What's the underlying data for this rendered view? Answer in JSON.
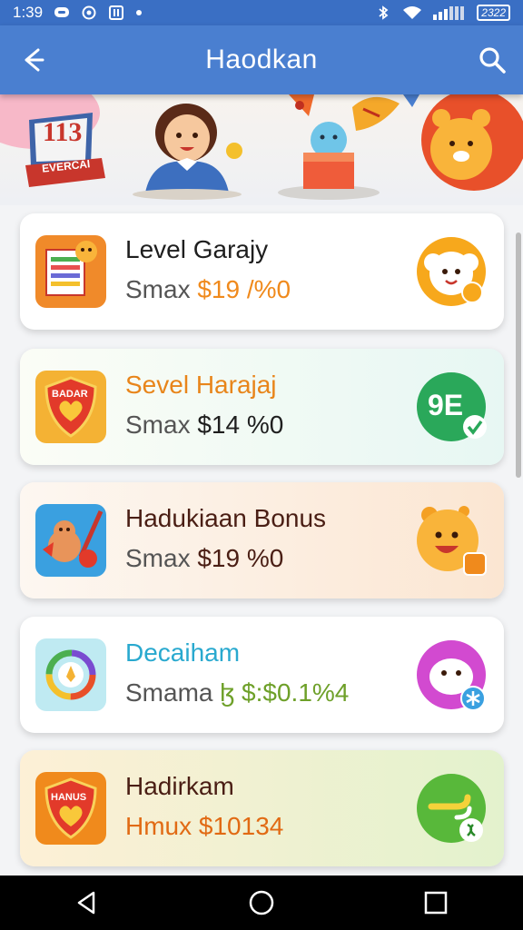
{
  "status_bar": {
    "time": "1:39",
    "battery": "2322"
  },
  "app_bar": {
    "title": "Haodkan"
  },
  "banner": {
    "badge_number": "113",
    "ribbon_text": "EVERCAI"
  },
  "cards": [
    {
      "title": "Level Garajy",
      "sub_prefix": "Smax",
      "sub_value": "$19 /%0",
      "title_color": "#1e1e1e",
      "value_color": "#f08a1c",
      "background": "#ffffff",
      "left_icon": "notebook-icon",
      "badge_icon": "sheep-face-icon"
    },
    {
      "title": "Sevel Harajaj",
      "sub_prefix": "Smax",
      "sub_value": "$14 %0",
      "title_color": "#e8851a",
      "value_color": "#1e1e1e",
      "background": "linear-gradient(90deg,#fbfdf6,#e7f7f3)",
      "left_icon": "shield-heart-icon",
      "badge_icon": "green-check-badge-icon",
      "left_icon_text": "BADAR",
      "badge_text": "9E"
    },
    {
      "title": "Hadukiaan Bonus",
      "sub_prefix": "Smax",
      "sub_value": "$19 %0",
      "title_color": "#4a1e14",
      "value_color": "#4a1e14",
      "background": "linear-gradient(90deg,#fdf7f1,#fbe6d2)",
      "left_icon": "squirrel-rocket-icon",
      "badge_icon": "orange-bear-icon"
    },
    {
      "title": "Decaiham",
      "sub_prefix": "Smama",
      "sub_value": "ɮ $:$0.1%4",
      "title_color": "#29a9cf",
      "value_color": "#6ea029",
      "background": "#ffffff",
      "left_icon": "color-wheel-icon",
      "badge_icon": "pink-creature-icon"
    },
    {
      "title": "Hadirkam",
      "sub_prefix": "Hmux",
      "sub_value": "$10134",
      "title_color": "#4a1e14",
      "value_color": "#e16a14",
      "background": "linear-gradient(90deg,#fdf0d6,#e3f2cd)",
      "left_icon": "shield-heart-icon",
      "badge_icon": "green-leaf-badge-icon",
      "left_icon_text": "HANUS",
      "prefix_color": "#e16a14"
    }
  ]
}
